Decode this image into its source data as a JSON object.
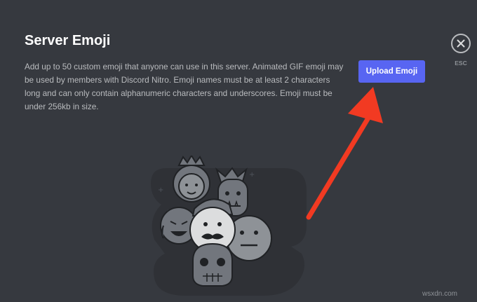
{
  "server_emoji": {
    "title": "Server Emoji",
    "description": "Add up to 50 custom emoji that anyone can use in this server. Animated GIF emoji may be used by members with Discord Nitro. Emoji names must be at least 2 characters long and can only contain alphanumeric characters and underscores. Emoji must be under 256kb in size.",
    "upload_button_label": "Upload Emoji"
  },
  "close": {
    "icon": "close-icon",
    "label": "ESC"
  },
  "illustration": {
    "icon": "emoji-group-illustration"
  },
  "annotation": {
    "icon": "red-arrow",
    "color": "#f23a22"
  },
  "watermark": "wsxdn.com",
  "colors": {
    "background": "#36393f",
    "accent": "#5865f2",
    "title": "#ffffff",
    "body_text": "#b9bbbe",
    "muted": "#8e9297"
  }
}
